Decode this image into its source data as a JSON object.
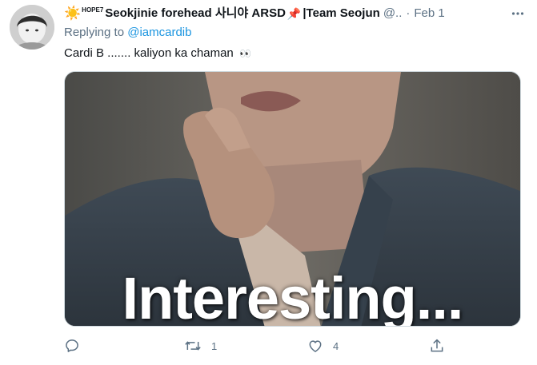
{
  "tweet": {
    "author": {
      "sun_glyph": "☀️",
      "badge_text": "HOPE7",
      "display_name": "Seokjinie forehead 사니야 ARSD",
      "pin_glyph": "📌",
      "team_text": "|Team Seojun",
      "handle": "@..",
      "separator": "·",
      "date": "Feb 1",
      "avatar_icon": "avatar-photo"
    },
    "more_icon": "more-icon",
    "reply": {
      "prefix": "Replying to",
      "mention": "@iamcardib"
    },
    "text": "Cardi B ....... kaliyon ka chaman",
    "text_emoji": "👀",
    "media": {
      "caption": "Interesting..."
    },
    "actions": {
      "reply_count": "",
      "retweet_count": "1",
      "like_count": "4",
      "share_count": ""
    },
    "colors": {
      "secondary_text": "#5b7083",
      "link": "#1b95e0",
      "primary_text": "#0f1419"
    }
  }
}
